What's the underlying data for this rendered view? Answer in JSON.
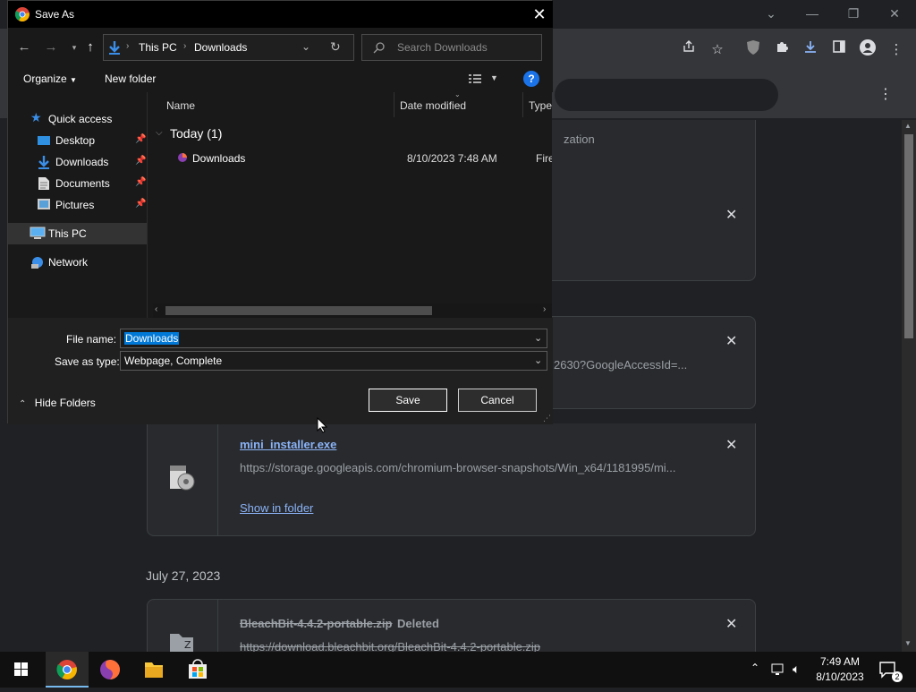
{
  "browser": {
    "window_controls": {
      "minimize": "—",
      "restore": "❐",
      "close": "✕",
      "tab_search": "⌄"
    },
    "downloads": {
      "partial_text": "zation",
      "url_fragment": "2630?GoogleAccessId=...",
      "items": [
        {
          "filename": "mini_installer.exe",
          "url": "https://storage.googleapis.com/chromium-browser-snapshots/Win_x64/1181995/mi...",
          "action": "Show in folder"
        },
        {
          "filename": "BleachBit-4.4.2-portable.zip",
          "status": "Deleted",
          "url": "https://download.bleachbit.org/BleachBit-4.4.2-portable.zip"
        }
      ],
      "date_group": "July 27, 2023"
    }
  },
  "dialog": {
    "title": "Save As",
    "breadcrumb": {
      "root": "This PC",
      "folder": "Downloads"
    },
    "search_placeholder": "Search Downloads",
    "toolbar": {
      "organize": "Organize",
      "new_folder": "New folder"
    },
    "nav": {
      "quick_access": "Quick access",
      "desktop": "Desktop",
      "downloads": "Downloads",
      "documents": "Documents",
      "pictures": "Pictures",
      "this_pc": "This PC",
      "network": "Network"
    },
    "columns": {
      "name": "Name",
      "date": "Date modified",
      "type": "Type"
    },
    "group": "Today (1)",
    "file": {
      "name": "Downloads",
      "date": "8/10/2023 7:48 AM",
      "type": "Firefo"
    },
    "labels": {
      "file_name": "File name:",
      "save_as_type": "Save as type:"
    },
    "values": {
      "file_name": "Downloads",
      "save_as_type": "Webpage, Complete"
    },
    "buttons": {
      "save": "Save",
      "cancel": "Cancel",
      "hide_folders": "Hide Folders"
    }
  },
  "taskbar": {
    "time": "7:49 AM",
    "date": "8/10/2023",
    "notifications": "2"
  }
}
